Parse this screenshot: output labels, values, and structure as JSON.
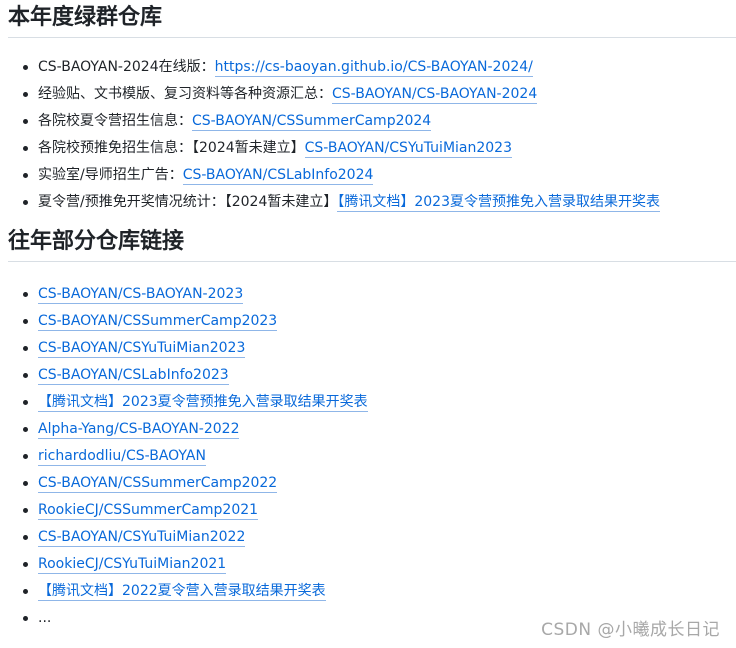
{
  "sections": {
    "current": {
      "heading": "本年度绿群仓库",
      "items": [
        {
          "text": "CS-BAOYAN-2024在线版：",
          "link": "https://cs-baoyan.github.io/CS-BAOYAN-2024/"
        },
        {
          "text": "经验贴、文书模版、复习资料等各种资源汇总：",
          "link": "CS-BAOYAN/CS-BAOYAN-2024"
        },
        {
          "text": "各院校夏令营招生信息：",
          "link": "CS-BAOYAN/CSSummerCamp2024"
        },
        {
          "text": "各院校预推免招生信息：【2024暂未建立】",
          "link": "CS-BAOYAN/CSYuTuiMian2023"
        },
        {
          "text": "实验室/导师招生广告：",
          "link": "CS-BAOYAN/CSLabInfo2024"
        },
        {
          "text": "夏令营/预推免开奖情况统计：【2024暂未建立】",
          "link": "【腾讯文档】2023夏令营预推免入营录取结果开奖表"
        }
      ]
    },
    "past": {
      "heading": "往年部分仓库链接",
      "items": [
        {
          "link": "CS-BAOYAN/CS-BAOYAN-2023"
        },
        {
          "link": "CS-BAOYAN/CSSummerCamp2023"
        },
        {
          "link": "CS-BAOYAN/CSYuTuiMian2023"
        },
        {
          "link": "CS-BAOYAN/CSLabInfo2023"
        },
        {
          "link": "【腾讯文档】2023夏令营预推免入营录取结果开奖表"
        },
        {
          "link": "Alpha-Yang/CS-BAOYAN-2022"
        },
        {
          "link": "richardodliu/CS-BAOYAN"
        },
        {
          "link": "CS-BAOYAN/CSSummerCamp2022"
        },
        {
          "link": "RookieCJ/CSSummerCamp2021"
        },
        {
          "link": "CS-BAOYAN/CSYuTuiMian2022"
        },
        {
          "link": "RookieCJ/CSYuTuiMian2021"
        },
        {
          "link": "【腾讯文档】2022夏令营入营录取结果开奖表"
        }
      ],
      "ellipsis": "..."
    }
  },
  "watermark": "CSDN @小曦成长日记",
  "colors": {
    "link": "#0969da",
    "text": "#1f2328",
    "rule": "#d8dee4",
    "watermark": "#a8a8a8"
  }
}
